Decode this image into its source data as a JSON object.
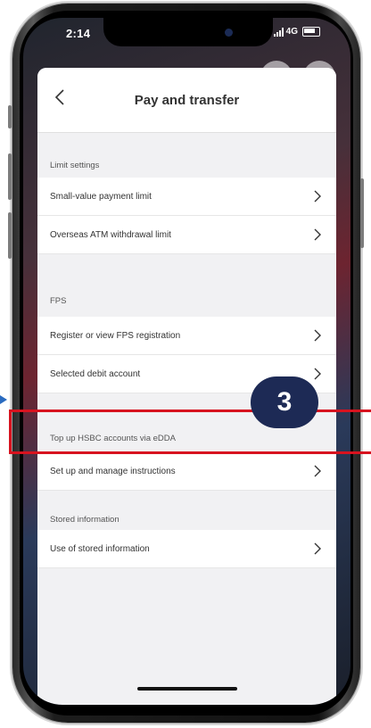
{
  "status_bar": {
    "time": "2:14",
    "network": "4G"
  },
  "nav": {
    "title": "Pay and transfer"
  },
  "sections": [
    {
      "header": "Limit settings",
      "rows": [
        "Small-value payment limit",
        "Overseas ATM withdrawal limit"
      ]
    },
    {
      "header": "FPS",
      "rows": [
        "Register or view FPS registration",
        "Selected debit account"
      ]
    },
    {
      "header": "Top up HSBC accounts via eDDA",
      "rows": [
        "Set up and manage instructions"
      ]
    },
    {
      "header": "Stored information",
      "rows": [
        "Use of stored information"
      ]
    }
  ],
  "annotation": {
    "step_number": "3",
    "highlight_color": "#d7131f",
    "badge_color": "#1d2a55"
  },
  "icons": [
    "back-chevron-icon",
    "chevron-right-icon",
    "signal-icon",
    "battery-icon"
  ]
}
